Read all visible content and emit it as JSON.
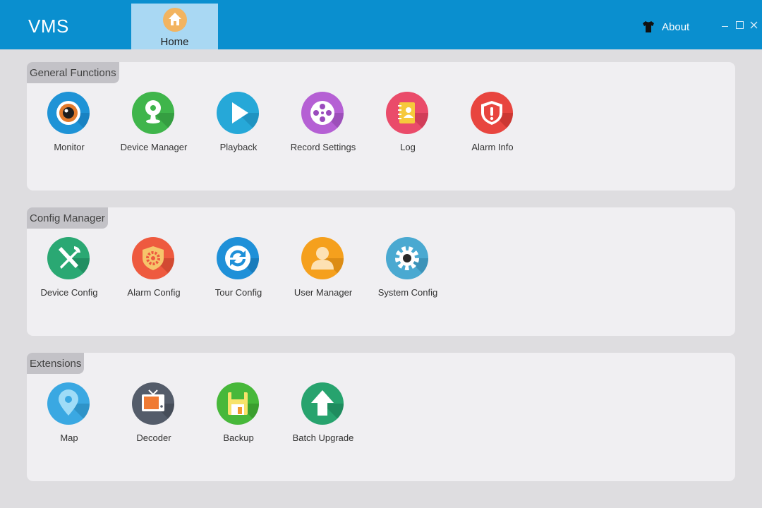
{
  "app": {
    "title": "VMS"
  },
  "tabs": [
    {
      "label": "Home",
      "icon": "home-icon"
    }
  ],
  "header": {
    "about_label": "About",
    "about_icon": "tshirt-icon"
  },
  "sections": [
    {
      "label": "General Functions",
      "items": [
        {
          "label": "Monitor",
          "icon": "camera-lens-icon",
          "color": "#1f93d6"
        },
        {
          "label": "Device Manager",
          "icon": "webcam-icon",
          "color": "#3fb54b"
        },
        {
          "label": "Playback",
          "icon": "play-icon",
          "color": "#26a8d8"
        },
        {
          "label": "Record Settings",
          "icon": "film-reel-icon",
          "color": "#b560d4"
        },
        {
          "label": "Log",
          "icon": "notebook-icon",
          "color": "#ea4b6a"
        },
        {
          "label": "Alarm Info",
          "icon": "alert-shield-icon",
          "color": "#e8453f"
        }
      ]
    },
    {
      "label": "Config Manager",
      "items": [
        {
          "label": "Device Config",
          "icon": "tools-icon",
          "color": "#2aa873"
        },
        {
          "label": "Alarm Config",
          "icon": "gear-shield-icon",
          "color": "#ee5a3f"
        },
        {
          "label": "Tour Config",
          "icon": "refresh-icon",
          "color": "#1f90d8"
        },
        {
          "label": "User Manager",
          "icon": "user-icon",
          "color": "#f5a01d"
        },
        {
          "label": "System Config",
          "icon": "gear-icon",
          "color": "#4aa9d1"
        }
      ]
    },
    {
      "label": "Extensions",
      "items": [
        {
          "label": "Map",
          "icon": "map-pin-icon",
          "color": "#3aa8e2"
        },
        {
          "label": "Decoder",
          "icon": "tv-icon",
          "color": "#545c6a"
        },
        {
          "label": "Backup",
          "icon": "floppy-disk-icon",
          "color": "#47b83a"
        },
        {
          "label": "Batch Upgrade",
          "icon": "upload-arrow-icon",
          "color": "#27a36e"
        }
      ]
    }
  ]
}
